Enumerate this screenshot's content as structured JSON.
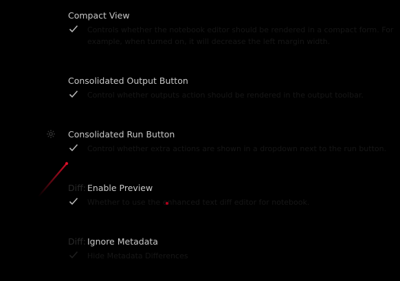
{
  "settings": [
    {
      "title": "Compact View",
      "checked": true,
      "description": "Controls whether the notebook editor should be rendered in a compact form. For example, when turned on, it will decrease the left margin width."
    },
    {
      "title": "Consolidated Output Button",
      "checked": true,
      "description": "Control whether outputs action should be rendered in the output toolbar."
    },
    {
      "title": "Consolidated Run Button",
      "checked": true,
      "description": "Control whether extra actions are shown in a dropdown next to the run button."
    },
    {
      "prefix": "Diff:",
      "title": "Enable Preview",
      "checked": true,
      "description": "Whether to use the enhanced text diff editor for notebook."
    },
    {
      "prefix": "Diff:",
      "title": "Ignore Metadata",
      "checked": false,
      "description": "Hide Metadata Differences"
    }
  ],
  "icons": {
    "check": "check-icon",
    "gear": "gear-icon"
  },
  "colors": {
    "background": "#000000",
    "title": "#c9c9c9",
    "check": "#b8b8b8",
    "cursor_trail": "#e0102a"
  }
}
